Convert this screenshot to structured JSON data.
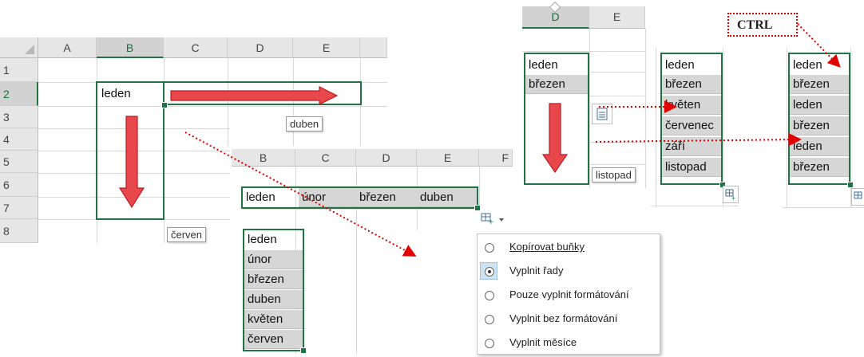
{
  "panel1": {
    "columns": [
      "A",
      "B",
      "C",
      "D",
      "E"
    ],
    "rows": [
      "1",
      "2",
      "3",
      "4",
      "5",
      "6",
      "7",
      "8"
    ],
    "start_cell": "leden",
    "tooltip_right": "duben",
    "tooltip_down": "červen"
  },
  "panel2": {
    "columns": [
      "B",
      "C",
      "D",
      "E",
      "F"
    ],
    "row_values": [
      "leden",
      "únor",
      "březen",
      "duben"
    ],
    "col_values": [
      "leden",
      "únor",
      "březen",
      "duben",
      "květen",
      "červen"
    ],
    "menu": [
      {
        "label": "Kopírovat buňky",
        "selected": false
      },
      {
        "label": "Vyplnit řady",
        "selected": true
      },
      {
        "label": "Pouze vyplnit formátování",
        "selected": false
      },
      {
        "label": "Vyplnit bez formátování",
        "selected": false
      },
      {
        "label": "Vyplnit měsíce",
        "selected": false
      }
    ]
  },
  "panel3": {
    "columns": [
      "D",
      "E"
    ],
    "values": [
      "leden",
      "březen"
    ],
    "tooltip": "listopad"
  },
  "panel4": {
    "values": [
      "leden",
      "březen",
      "květen",
      "červenec",
      "září",
      "listopad"
    ]
  },
  "panel5": {
    "label": "CTRL",
    "values": [
      "leden",
      "březen",
      "leden",
      "březen",
      "leden",
      "březen"
    ]
  },
  "icons": {
    "arrow_color": "#e8474c",
    "dotted_arrow_color": "#e00000",
    "selection_color": "#217346"
  }
}
